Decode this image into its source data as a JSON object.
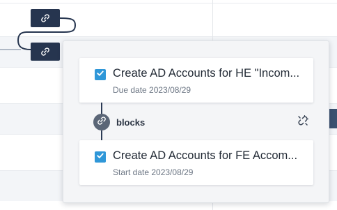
{
  "popover": {
    "relation_label": "blocks",
    "tasks": [
      {
        "title": "Create AD Accounts for HE \"Incom...",
        "date_label": "Due date 2023/08/29",
        "checked": true
      },
      {
        "title": "Create AD Accounts for FE Accom...",
        "date_label": "Start date 2023/08/29",
        "checked": true
      }
    ]
  },
  "icons": {
    "link_chip_top": "link-icon",
    "link_chip_bottom": "link-icon",
    "relation": "link-icon",
    "unlink": "unlink-icon",
    "checkbox": "checkmark-icon"
  },
  "colors": {
    "chip_background": "#26354f",
    "checkbox": "#2f97d8",
    "relation_circle": "#5b6677",
    "gantt_bar": "#3b5170"
  }
}
